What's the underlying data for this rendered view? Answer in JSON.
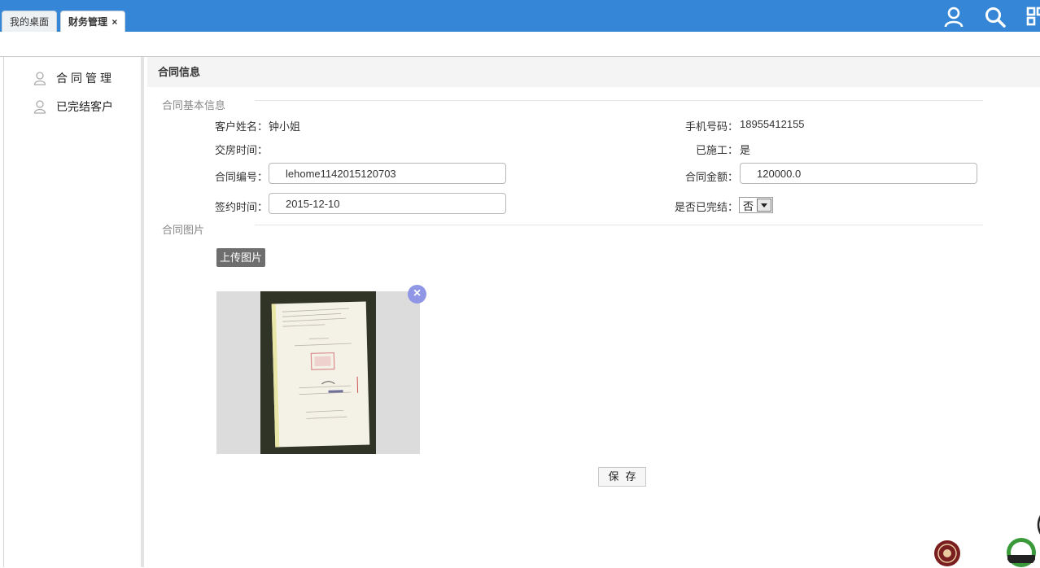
{
  "tabs": [
    {
      "label": "我的桌面"
    },
    {
      "label": "财务管理",
      "close": "×"
    }
  ],
  "sidebar": {
    "items": [
      {
        "label": "合同管理"
      },
      {
        "label": "已完结客户"
      }
    ]
  },
  "panel": {
    "title": "合同信息",
    "basic_section": "合同基本信息",
    "image_section": "合同图片"
  },
  "form": {
    "customer_name_label": "客户姓名：",
    "customer_name": "钟小姐",
    "phone_label": "手机号码：",
    "phone": "18955412155",
    "handover_label": "交房时间：",
    "handover": "",
    "constructed_label": "已施工：",
    "constructed": "是",
    "contract_no_label": "合同编号：",
    "contract_no": "lehome1142015120703",
    "amount_label": "合同金额：",
    "amount": "120000.0",
    "sign_date_label": "签约时间：",
    "sign_date": "2015-12-10",
    "finished_label": "是否已完结：",
    "finished": "否"
  },
  "upload_label": "上传图片",
  "remove_label": "×",
  "save_label": "保存",
  "colors": {
    "topbar": "#3586d6",
    "remove_button": "#8f96e6"
  }
}
